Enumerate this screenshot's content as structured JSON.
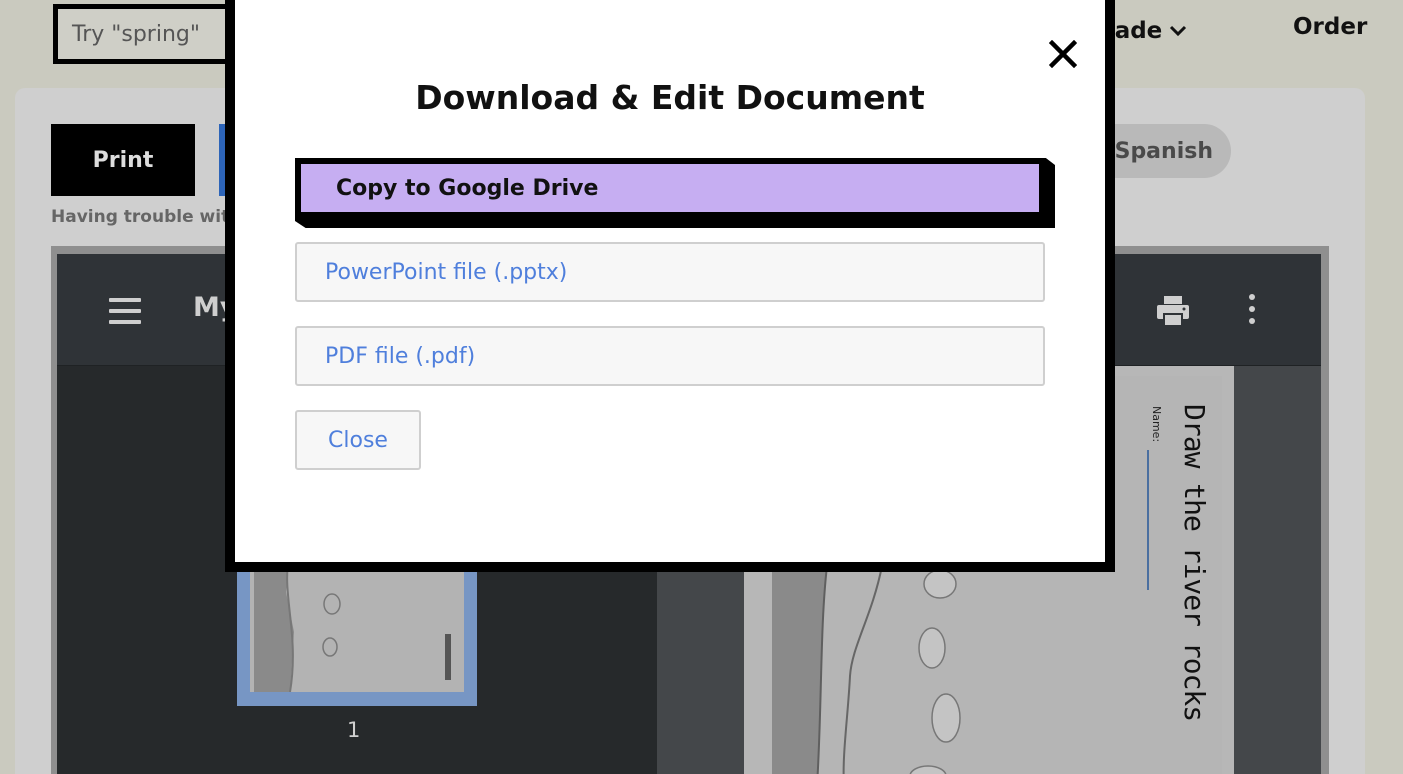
{
  "header": {
    "search_placeholder": "Try \"spring\"",
    "grade_label": "d Grade",
    "order_label": "Order"
  },
  "toolbar": {
    "print_label": "Print",
    "spanish_label": "Spanish",
    "trouble_text": "Having trouble with"
  },
  "viewer": {
    "title": "My",
    "thumbnail_page_number": "1",
    "page_heading": "Draw the river rocks",
    "name_label": "Name:"
  },
  "modal": {
    "title": "Download & Edit Document",
    "options": {
      "google_drive": "Copy to Google Drive",
      "pptx": "PowerPoint file (.pptx)",
      "pdf": "PDF file (.pdf)"
    },
    "close_label": "Close"
  },
  "colors": {
    "accent_purple": "#c6aef2",
    "link_blue": "#4f7fdc",
    "viewer_dark": "#26292b"
  },
  "icons": [
    "close-icon",
    "chevron-down-icon",
    "menu-icon",
    "printer-icon",
    "more-vertical-icon"
  ]
}
